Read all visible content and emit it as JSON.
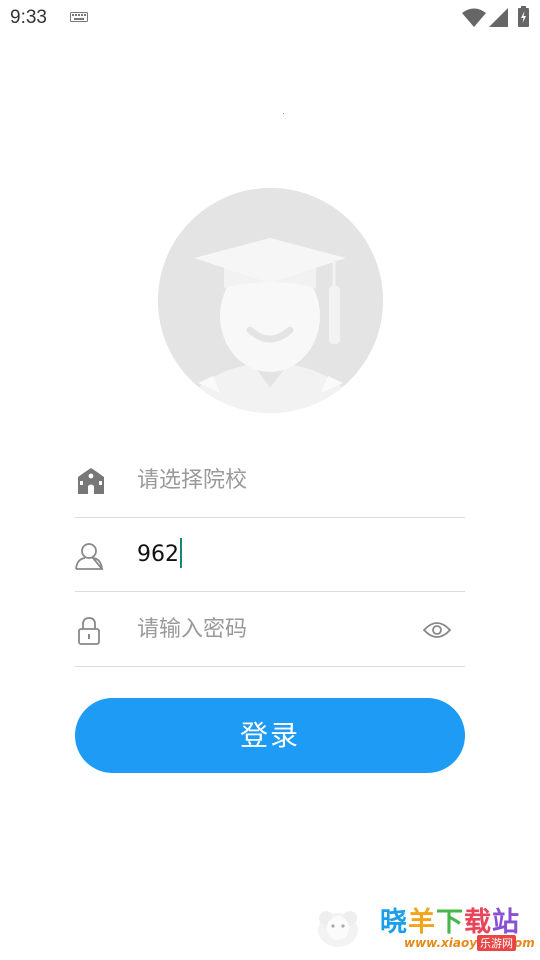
{
  "status_bar": {
    "time": "9:33",
    "keyboard_icon": "keyboard-icon",
    "wifi_icon": "wifi-icon",
    "signal_icon": "signal-icon",
    "battery_icon": "battery-charging-icon"
  },
  "avatar": {
    "icon": "graduate-avatar-icon"
  },
  "form": {
    "school": {
      "placeholder": "请选择院校",
      "icon": "school-building-icon"
    },
    "username": {
      "value": "962",
      "icon": "user-icon"
    },
    "password": {
      "placeholder": "请输入密码",
      "icon": "lock-icon",
      "toggle_icon": "eye-icon"
    }
  },
  "login_button": {
    "label": "登录"
  },
  "colors": {
    "accent": "#1e9bf5",
    "caret": "#17877a",
    "placeholder": "#9a9a9a",
    "divider": "#dcdcdc",
    "avatar_bg": "#e4e4e4"
  },
  "watermark": {
    "title_chars": [
      "晓",
      "羊",
      "下",
      "载",
      "站"
    ],
    "url": "www.xiaoyang.com",
    "badge": "乐游网"
  }
}
